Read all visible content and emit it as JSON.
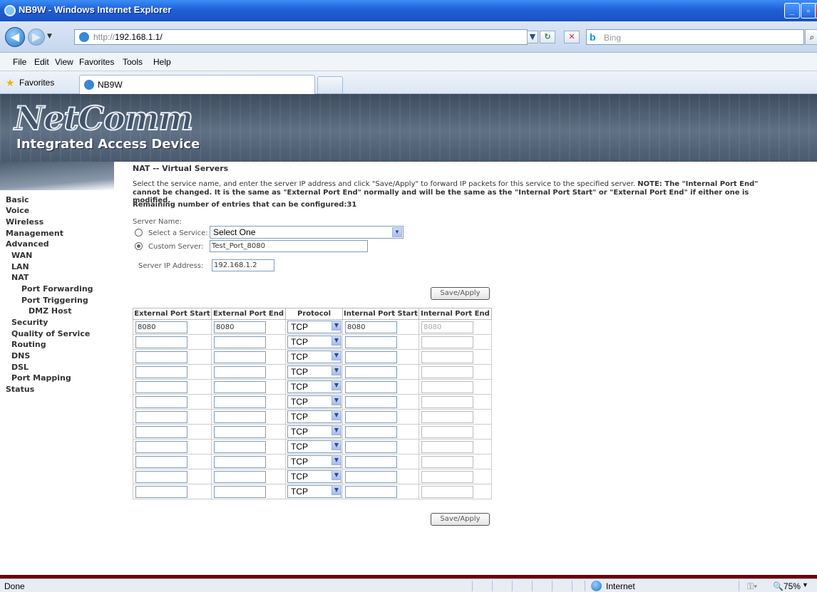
{
  "window": {
    "title": "NB9W - Windows Internet Explorer"
  },
  "address_bar": {
    "url_prefix": "http://",
    "url_host": "192.168.1.1/",
    "search_placeholder": "Bing"
  },
  "menu": [
    "File",
    "Edit",
    "View",
    "Favorites",
    "Tools",
    "Help"
  ],
  "favorites_bar": {
    "label": "Favorites",
    "active_tab": "NB9W"
  },
  "banner": {
    "logo": "NetComm",
    "tagline": "Integrated Access Device"
  },
  "sidebar": {
    "items": [
      {
        "label": "Basic",
        "level": 0
      },
      {
        "label": "Voice",
        "level": 0
      },
      {
        "label": "Wireless",
        "level": 0
      },
      {
        "label": "Management",
        "level": 0
      },
      {
        "label": "Advanced",
        "level": 0
      },
      {
        "label": "WAN",
        "level": 1
      },
      {
        "label": "LAN",
        "level": 1
      },
      {
        "label": "NAT",
        "level": 1
      },
      {
        "label": "Port Forwarding",
        "level": 2
      },
      {
        "label": "Port Triggering",
        "level": 2
      },
      {
        "label": "DMZ Host",
        "level": 2
      },
      {
        "label": "Security",
        "level": 1
      },
      {
        "label": "Quality of Service",
        "level": 1
      },
      {
        "label": "Routing",
        "level": 1
      },
      {
        "label": "DNS",
        "level": 1
      },
      {
        "label": "DSL",
        "level": 1
      },
      {
        "label": "Port Mapping",
        "level": 1
      },
      {
        "label": "Status",
        "level": 0
      }
    ]
  },
  "page": {
    "title": "NAT -- Virtual Servers",
    "description_plain": "Select the service name, and enter the server IP address and click \"Save/Apply\" to forward IP packets for this service to the specified server. ",
    "description_note": "NOTE: The \"Internal Port End\" cannot be changed. It is the same as \"External Port End\" normally and will be the same as the \"Internal Port Start\" or \"External Port End\" if either one is modified.",
    "remaining": "Remaining number of entries that can be configured:31",
    "server_name_label": "Server Name:",
    "select_service_label": "Select a Service:",
    "select_service_value": "Select One",
    "custom_server_label": "Custom Server:",
    "custom_server_value": "Test_Port_8080",
    "server_ip_label": "Server IP Address:",
    "server_ip_value": "192.168.1.2",
    "save_label": "Save/Apply",
    "custom_selected": true
  },
  "table": {
    "headers": [
      "External Port Start",
      "External Port End",
      "Protocol",
      "Internal Port Start",
      "Internal Port End"
    ],
    "rows": [
      {
        "ext_start": "8080",
        "ext_end": "8080",
        "protocol": "TCP",
        "int_start": "8080",
        "int_end": "8080"
      },
      {
        "ext_start": "",
        "ext_end": "",
        "protocol": "TCP",
        "int_start": "",
        "int_end": ""
      },
      {
        "ext_start": "",
        "ext_end": "",
        "protocol": "TCP",
        "int_start": "",
        "int_end": ""
      },
      {
        "ext_start": "",
        "ext_end": "",
        "protocol": "TCP",
        "int_start": "",
        "int_end": ""
      },
      {
        "ext_start": "",
        "ext_end": "",
        "protocol": "TCP",
        "int_start": "",
        "int_end": ""
      },
      {
        "ext_start": "",
        "ext_end": "",
        "protocol": "TCP",
        "int_start": "",
        "int_end": ""
      },
      {
        "ext_start": "",
        "ext_end": "",
        "protocol": "TCP",
        "int_start": "",
        "int_end": ""
      },
      {
        "ext_start": "",
        "ext_end": "",
        "protocol": "TCP",
        "int_start": "",
        "int_end": ""
      },
      {
        "ext_start": "",
        "ext_end": "",
        "protocol": "TCP",
        "int_start": "",
        "int_end": ""
      },
      {
        "ext_start": "",
        "ext_end": "",
        "protocol": "TCP",
        "int_start": "",
        "int_end": ""
      },
      {
        "ext_start": "",
        "ext_end": "",
        "protocol": "TCP",
        "int_start": "",
        "int_end": ""
      },
      {
        "ext_start": "",
        "ext_end": "",
        "protocol": "TCP",
        "int_start": "",
        "int_end": ""
      }
    ]
  },
  "status_bar": {
    "left": "Done",
    "zone": "Internet",
    "zoom": "75%"
  },
  "colors": {
    "title_bar": "#1f5fd6",
    "banner": "#5f7185",
    "bottom_stripe": "#6d0000"
  }
}
